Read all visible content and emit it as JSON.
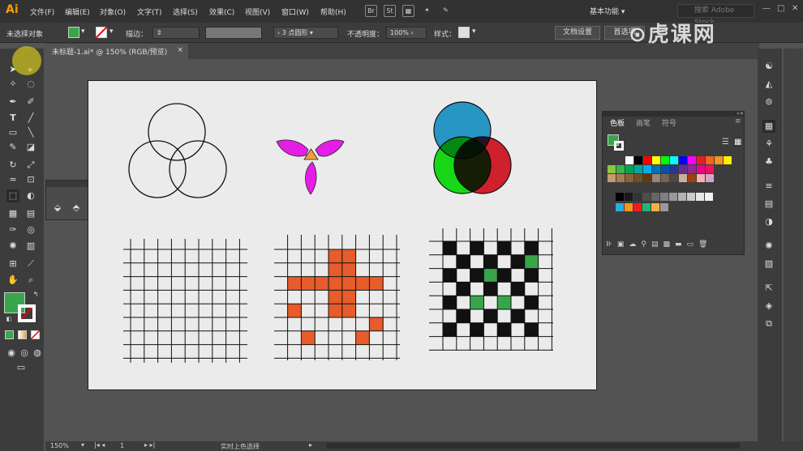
{
  "app": {
    "logo": "Ai"
  },
  "menu": [
    "文件(F)",
    "编辑(E)",
    "对象(O)",
    "文字(T)",
    "选择(S)",
    "效果(C)",
    "视图(V)",
    "窗口(W)",
    "帮助(H)"
  ],
  "menu_icons": [
    "Br",
    "St"
  ],
  "workspace_label": "基本功能",
  "stock_search": {
    "placeholder": "搜索 Adobe Stock"
  },
  "control": {
    "selection_status": "未选择对象",
    "stroke_label": "描边：",
    "brush_label": "3 点圆形",
    "opacity_label": "不透明度：",
    "opacity_value": "100%",
    "style_label": "样式：",
    "doc_setup": "文档设置",
    "preferences": "首选项"
  },
  "document_tab": {
    "title": "未标题-1.ai* @ 150% (RGB/预览)",
    "close": "×"
  },
  "swatch_panel": {
    "tabs": [
      "色板",
      "画笔",
      "符号"
    ],
    "row1": [
      "#ffffff",
      "#000000",
      "#ff0000",
      "#ffff00",
      "#00ff00",
      "#00ffff",
      "#0000ff",
      "#ff00ff",
      "#ed1c24",
      "#f26522",
      "#f7941d",
      "#fff200"
    ],
    "row2": [
      "#8dc63f",
      "#39b54a",
      "#00a651",
      "#00a99d",
      "#00aeef",
      "#0072bc",
      "#0054a6",
      "#2e3192",
      "#662d91",
      "#92278f",
      "#ec008c",
      "#ed145b"
    ],
    "row3": [
      "#c69c6d",
      "#a67c52",
      "#8c6239",
      "#754c24",
      "#603913",
      "#998675",
      "#736357",
      "#534741",
      "#c7b299",
      "#a0410d",
      "#f4b2b2",
      "#d4a5c9"
    ],
    "gray_row": [
      "#000000",
      "#1a1a1a",
      "#333333",
      "#4d4d4d",
      "#666666",
      "#808080",
      "#999999",
      "#b3b3b3",
      "#cccccc",
      "#e6e6e6",
      "#f2f2f2"
    ],
    "color_group": [
      "#29abe2",
      "#f7931e",
      "#ed1c24",
      "#22b573",
      "#fbb03b",
      "#999999"
    ]
  },
  "artwork_colors": {
    "petal": "#e51ee5",
    "triangle": "#f39c3c",
    "circle_blue": "#2aa3d6",
    "circle_green": "#19ea19",
    "circle_red": "#e02231",
    "orange_fill": "#e65c2a",
    "green_cell": "#37a64a"
  },
  "toolbar": {
    "fill_color": "#37a64a"
  },
  "status": {
    "zoom": "150%",
    "page": "1",
    "mode": "实时上色选择"
  },
  "watermark": "虎课网"
}
